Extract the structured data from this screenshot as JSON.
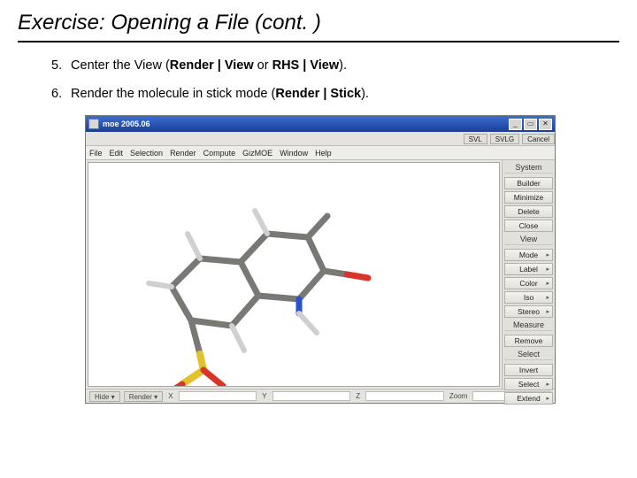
{
  "title": "Exercise: Opening a File (cont. )",
  "steps": [
    {
      "num": "5.",
      "pre": "Center the View (",
      "b1": "Render | View",
      "mid": " or ",
      "b2": "RHS | View",
      "post": ")."
    },
    {
      "num": "6.",
      "pre": "Render the molecule in stick mode (",
      "b1": "Render | Stick",
      "mid": "",
      "b2": "",
      "post": ")."
    }
  ],
  "app": {
    "title": "moe 2005.06",
    "winbtns": {
      "min": "_",
      "max": "▭",
      "close": "✕"
    },
    "topstrip": {
      "svl": "SVL",
      "svlg": "SVLG",
      "cancel": "Cancel"
    },
    "menu": [
      "File",
      "Edit",
      "Selection",
      "Render",
      "Compute",
      "GizMOE",
      "Window",
      "Help"
    ],
    "sidebar": {
      "system": "System",
      "sysbtns": [
        "Builder",
        "Minimize",
        "Delete",
        "Close"
      ],
      "view": "View",
      "viewbtns": [
        {
          "l": "Mode",
          "a": true
        },
        {
          "l": "Label",
          "a": true
        },
        {
          "l": "Color",
          "a": true
        },
        {
          "l": "Iso",
          "a": true
        },
        {
          "l": "Stereo",
          "a": true
        }
      ],
      "measure": "Measure",
      "mbtns": [
        "Remove"
      ],
      "select": "Select",
      "selbtns": [
        {
          "l": "Invert",
          "a": false
        },
        {
          "l": "Select",
          "a": true
        },
        {
          "l": "Extend",
          "a": true
        }
      ]
    },
    "status": {
      "hideBtn": "Hide ▾",
      "renderBtn": "Render ▾",
      "labels": [
        "X",
        "Y",
        "Z",
        "Zoom"
      ]
    }
  }
}
